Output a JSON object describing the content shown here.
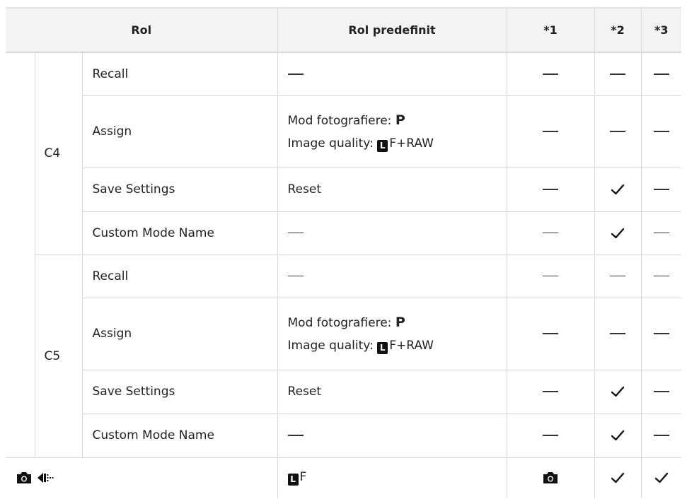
{
  "header": {
    "role": "Rol",
    "default_role": "Rol predefinit",
    "col1": "*1",
    "col2": "*2",
    "col3": "*3"
  },
  "groups": [
    {
      "name": "C4",
      "rows": [
        {
          "role": "Recall",
          "default": "",
          "c1": "dash",
          "c2": "dash",
          "c3": "dash"
        },
        {
          "role": "Assign",
          "default_line1_label": "Mod fotografiere: ",
          "default_line1_value": "P",
          "default_line2_label": "Image quality: ",
          "default_line2_value": "F+RAW",
          "c1": "dash",
          "c2": "dash",
          "c3": "dash"
        },
        {
          "role": "Save Settings",
          "default": "Reset",
          "c1": "dash",
          "c2": "check",
          "c3": "dash"
        },
        {
          "role": "Custom Mode Name",
          "default": "",
          "c1": "dash",
          "c2": "check",
          "c3": "dash"
        }
      ]
    },
    {
      "name": "C5",
      "rows": [
        {
          "role": "Recall",
          "default": "",
          "c1": "dash",
          "c2": "dash",
          "c3": "dash"
        },
        {
          "role": "Assign",
          "default_line1_label": "Mod fotografiere: ",
          "default_line1_value": "P",
          "default_line2_label": "Image quality: ",
          "default_line2_value": "F+RAW",
          "c1": "dash",
          "c2": "dash",
          "c3": "dash"
        },
        {
          "role": "Save Settings",
          "default": "Reset",
          "c1": "dash",
          "c2": "check",
          "c3": "dash"
        },
        {
          "role": "Custom Mode Name",
          "default": "",
          "c1": "dash",
          "c2": "check",
          "c3": "dash"
        }
      ]
    }
  ],
  "last_row": {
    "role_icons": [
      "camera-icon",
      "drive-mode-icon"
    ],
    "default_box": "L",
    "default_value": "F",
    "c1": "camera-icon",
    "c2": "check",
    "c3": "check"
  },
  "quality_box_letter": "L"
}
